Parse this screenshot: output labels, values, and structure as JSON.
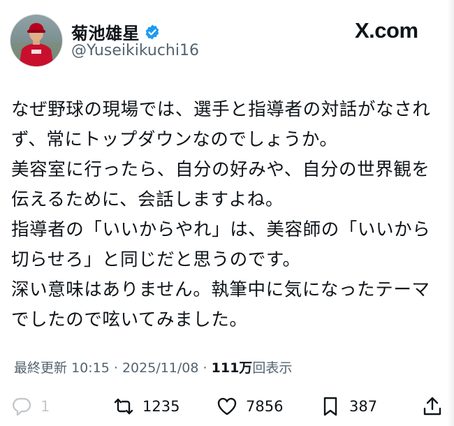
{
  "user": {
    "display_name": "菊池雄星",
    "handle": "@Yuseikikuchi16",
    "verified_icon": "verified-badge-icon",
    "avatar": "profile-photo-baseball-player"
  },
  "brand": {
    "logo_text": "X.com"
  },
  "tweet": {
    "lines": [
      "なぜ野球の現場では、選手と指導者の対話がなされ",
      "ず、常にトップダウンなのでしょうか。",
      "美容室に行ったら、自分の好みや、自分の世界観を",
      "伝えるために、会話しますよね。",
      "指導者の「いいからやれ」は、美容師の「いいから",
      "切らせろ」と同じだと思うのです。",
      "深い意味はありません。執筆中に気になったテーマ",
      "でしたので呟いてみました。"
    ]
  },
  "meta": {
    "updated_prefix": "最終更新",
    "time": "10:15",
    "separator": "·",
    "date": "2025/11/08",
    "views_count": "111",
    "views_unit": "万",
    "views_label": "回表示"
  },
  "actions": {
    "reply": {
      "icon": "reply-bubble-icon",
      "count": "1"
    },
    "repost": {
      "icon": "repost-icon",
      "count": "1235"
    },
    "like": {
      "icon": "heart-icon",
      "count": "7856"
    },
    "bookmark": {
      "icon": "bookmark-icon",
      "count": "387"
    },
    "share": {
      "icon": "share-icon"
    }
  },
  "colors": {
    "text": "#0f1419",
    "secondary": "#536471",
    "verified": "#1d9bf0",
    "muted": "#c4c9ce"
  }
}
